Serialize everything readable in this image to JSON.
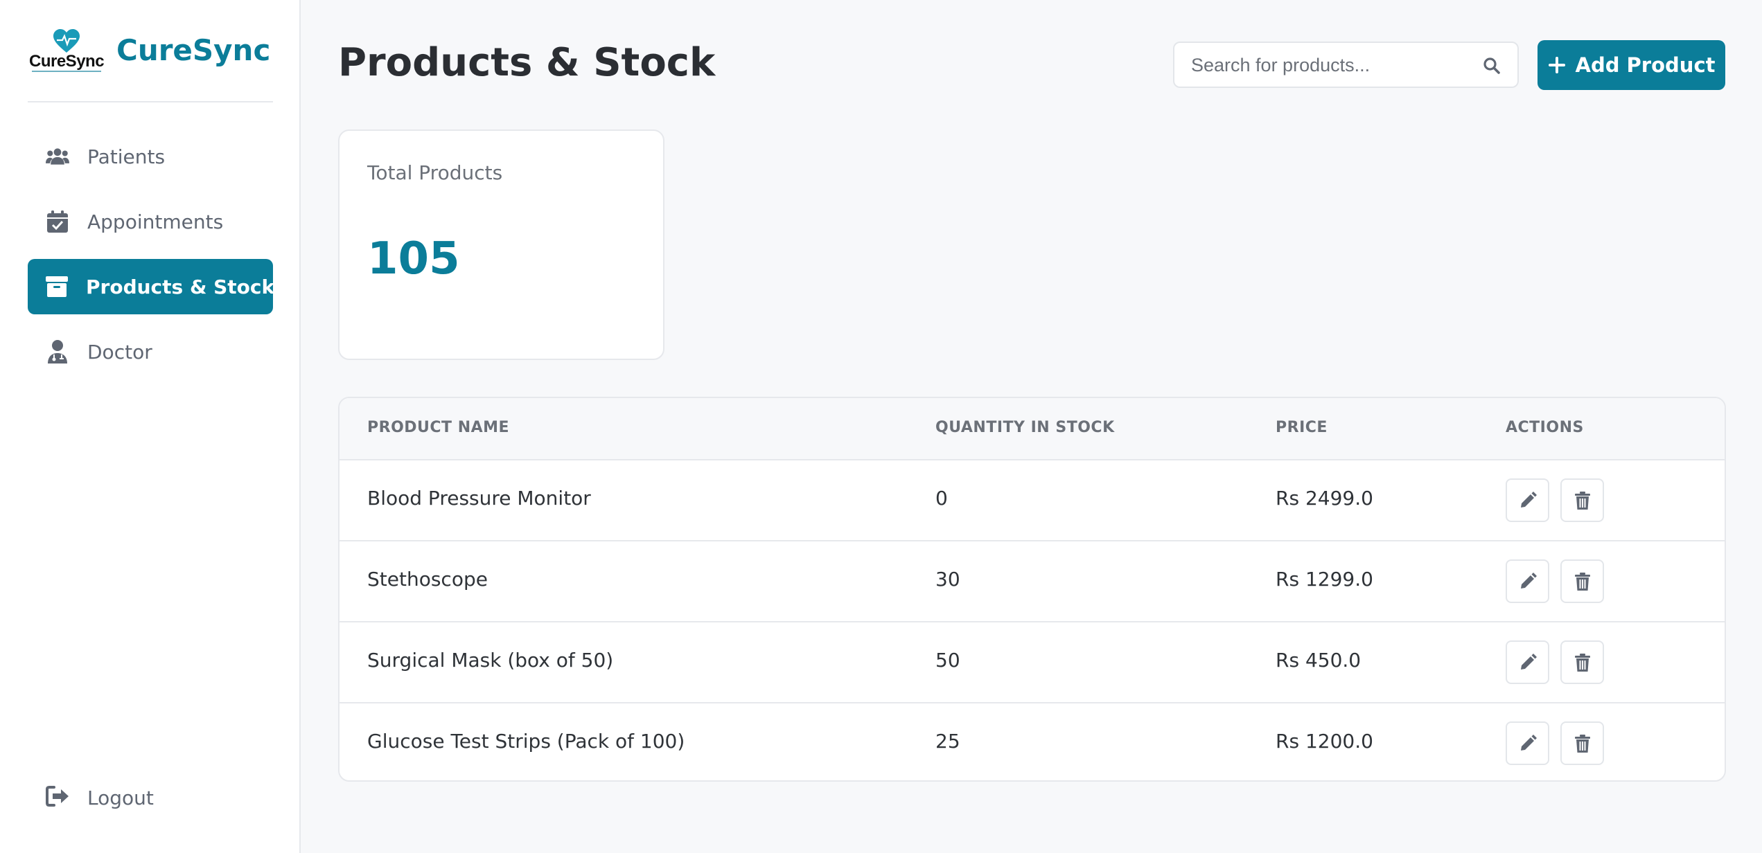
{
  "brand": {
    "logo_text": "CureSync",
    "name": "CureSync"
  },
  "sidebar": {
    "items": [
      {
        "label": "Patients",
        "icon": "users-icon",
        "active": false
      },
      {
        "label": "Appointments",
        "icon": "calendar-check-icon",
        "active": false
      },
      {
        "label": "Products & Stock",
        "icon": "archive-box-icon",
        "active": true
      },
      {
        "label": "Doctor",
        "icon": "doctor-icon",
        "active": false
      }
    ],
    "logout_label": "Logout",
    "logout_icon": "logout-icon"
  },
  "header": {
    "title": "Products & Stock",
    "search_placeholder": "Search for products...",
    "add_button_label": "Add Product"
  },
  "stats": {
    "total_products_label": "Total Products",
    "total_products_value": "105"
  },
  "table": {
    "columns": [
      "PRODUCT NAME",
      "QUANTITY IN STOCK",
      "PRICE",
      "ACTIONS"
    ],
    "rows": [
      {
        "name": "Blood Pressure Monitor",
        "quantity": "0",
        "price": "Rs 2499.0"
      },
      {
        "name": "Stethoscope",
        "quantity": "30",
        "price": "Rs 1299.0"
      },
      {
        "name": "Surgical Mask (box of 50)",
        "quantity": "50",
        "price": "Rs 450.0"
      },
      {
        "name": "Glucose Test Strips (Pack of 100)",
        "quantity": "25",
        "price": "Rs 1200.0"
      }
    ]
  },
  "colors": {
    "accent": "#0b7d99",
    "background": "#f7f8fa",
    "muted_text": "#6b7078"
  }
}
